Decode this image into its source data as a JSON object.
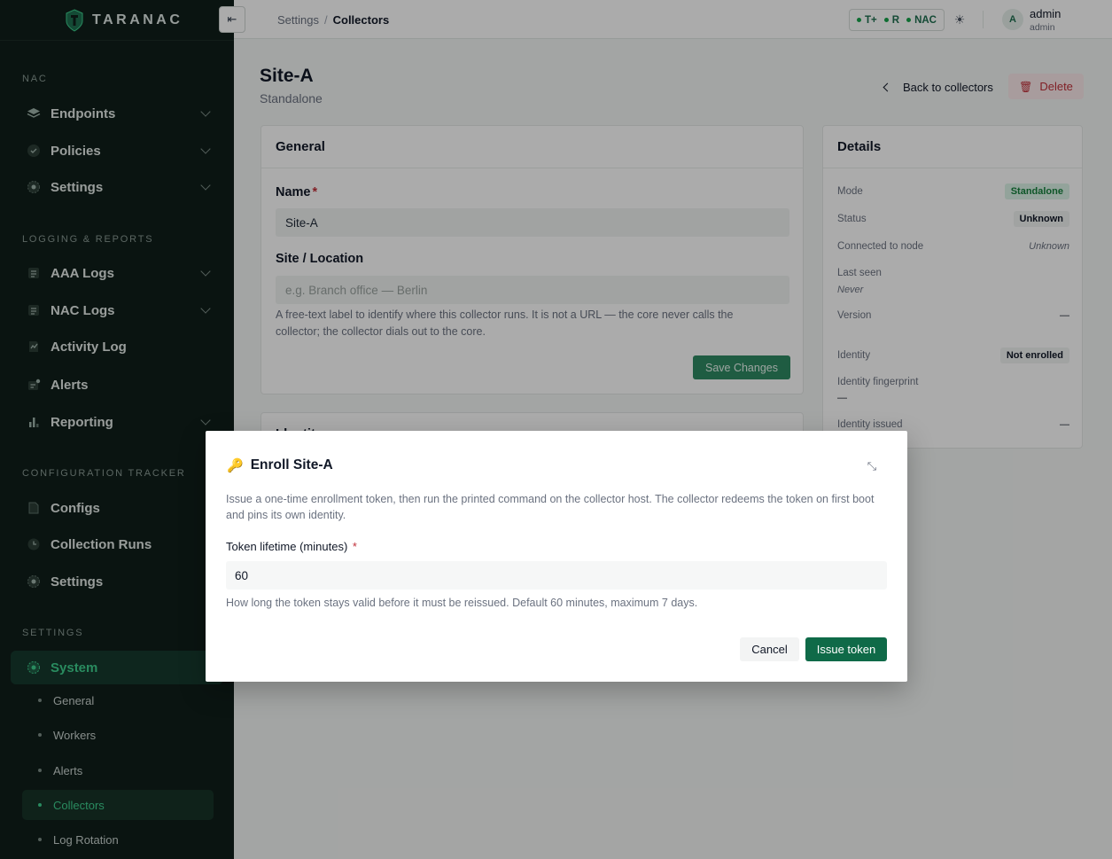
{
  "brand": {
    "name": "TARANAC",
    "logo_icon": "shield-logo-icon"
  },
  "sidebar": {
    "sections": [
      {
        "label": "NAC",
        "items": [
          {
            "label": "Endpoints",
            "icon": "layers-icon",
            "expandable": true
          },
          {
            "label": "Policies",
            "icon": "shield-check-icon",
            "expandable": true
          },
          {
            "label": "Settings",
            "icon": "gear-icon",
            "expandable": true
          }
        ]
      },
      {
        "label": "LOGGING & REPORTS",
        "items": [
          {
            "label": "AAA Logs",
            "icon": "log-list-icon",
            "expandable": true
          },
          {
            "label": "NAC Logs",
            "icon": "log-list-icon",
            "expandable": true
          },
          {
            "label": "Activity Log",
            "icon": "activity-icon",
            "expandable": false
          },
          {
            "label": "Alerts",
            "icon": "alert-icon",
            "expandable": false
          },
          {
            "label": "Reporting",
            "icon": "bar-chart-icon",
            "expandable": true
          }
        ]
      },
      {
        "label": "CONFIGURATION TRACKER",
        "items": [
          {
            "label": "Configs",
            "icon": "document-icon",
            "expandable": false
          },
          {
            "label": "Collection Runs",
            "icon": "clock-icon",
            "expandable": false
          },
          {
            "label": "Settings",
            "icon": "gear-icon",
            "expandable": false
          }
        ]
      },
      {
        "label": "SETTINGS",
        "items": [
          {
            "label": "System",
            "icon": "gear-icon",
            "active": true
          }
        ]
      }
    ],
    "system_subitems": [
      "General",
      "Workers",
      "Alerts",
      "Collectors",
      "Log Rotation"
    ],
    "active_subitem": "Collectors"
  },
  "topbar": {
    "breadcrumb": {
      "parent": "Settings",
      "separator": "/",
      "current": "Collectors"
    },
    "protocols": [
      "T+",
      "R",
      "NAC"
    ],
    "user": {
      "avatar": "A",
      "name": "admin",
      "role": "admin"
    }
  },
  "page": {
    "title": "Site-A",
    "subtitle": "Standalone",
    "back_label": "Back to collectors",
    "delete_label": "Delete"
  },
  "general_card": {
    "title": "General",
    "name_label": "Name",
    "name_required_mark": "*",
    "name_value": "Site-A",
    "site_label": "Site / Location",
    "site_placeholder": "e.g. Branch office — Berlin",
    "site_help": "A free-text label to identify where this collector runs. It is not a URL — the core never calls the collector; the collector dials out to the core.",
    "save_label": "Save Changes"
  },
  "identity_card": {
    "title": "Identity"
  },
  "details_card": {
    "title": "Details",
    "rows": {
      "mode": {
        "key": "Mode",
        "value": "Standalone"
      },
      "status": {
        "key": "Status",
        "value": "Unknown"
      },
      "connected": {
        "key": "Connected to node",
        "value": "Unknown"
      },
      "last_seen": {
        "key": "Last seen",
        "value": "Never"
      },
      "version": {
        "key": "Version",
        "value": "—"
      },
      "identity": {
        "key": "Identity",
        "value": "Not enrolled"
      },
      "fingerprint": {
        "key": "Identity fingerprint",
        "value": "—"
      },
      "issued": {
        "key": "Identity issued",
        "value": "—"
      }
    }
  },
  "modal": {
    "title": "Enroll Site-A",
    "description": "Issue a one-time enrollment token, then run the printed command on the collector host. The collector redeems the token on first boot and pins its own identity.",
    "lifetime_label": "Token lifetime (minutes)",
    "required_mark": "*",
    "lifetime_value": "60",
    "lifetime_help": "How long the token stays valid before it must be reissued. Default 60 minutes, maximum 7 days.",
    "cancel_label": "Cancel",
    "issue_label": "Issue token"
  },
  "colors": {
    "accent": "#0f6a48",
    "sidebar_bg": "#0f1f1a",
    "active_text": "#3ecf8e",
    "danger": "#c0303a"
  }
}
